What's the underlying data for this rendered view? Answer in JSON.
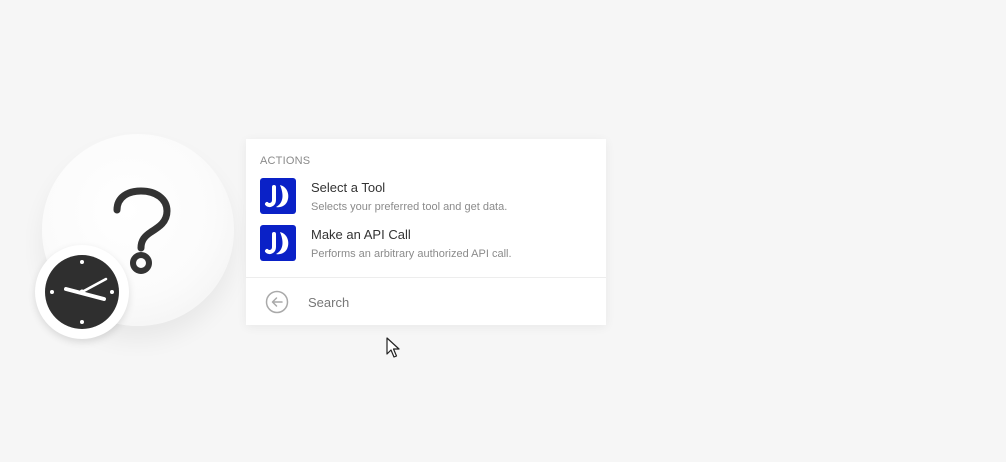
{
  "actions_panel": {
    "section_title": "ACTIONS",
    "items": [
      {
        "title": "Select a Tool",
        "description": "Selects your preferred tool and get data.",
        "icon": "app-logo-icon"
      },
      {
        "title": "Make an API Call",
        "description": "Performs an arbitrary authorized API call.",
        "icon": "app-logo-icon"
      }
    ],
    "search": {
      "placeholder": "Search",
      "value": ""
    }
  },
  "module": {
    "icon": "question-mark-icon",
    "trigger_icon": "clock-icon"
  },
  "colors": {
    "app_brand": "#0a21c7",
    "background": "#f6f6f6",
    "clock_face": "#2f2f2f"
  }
}
